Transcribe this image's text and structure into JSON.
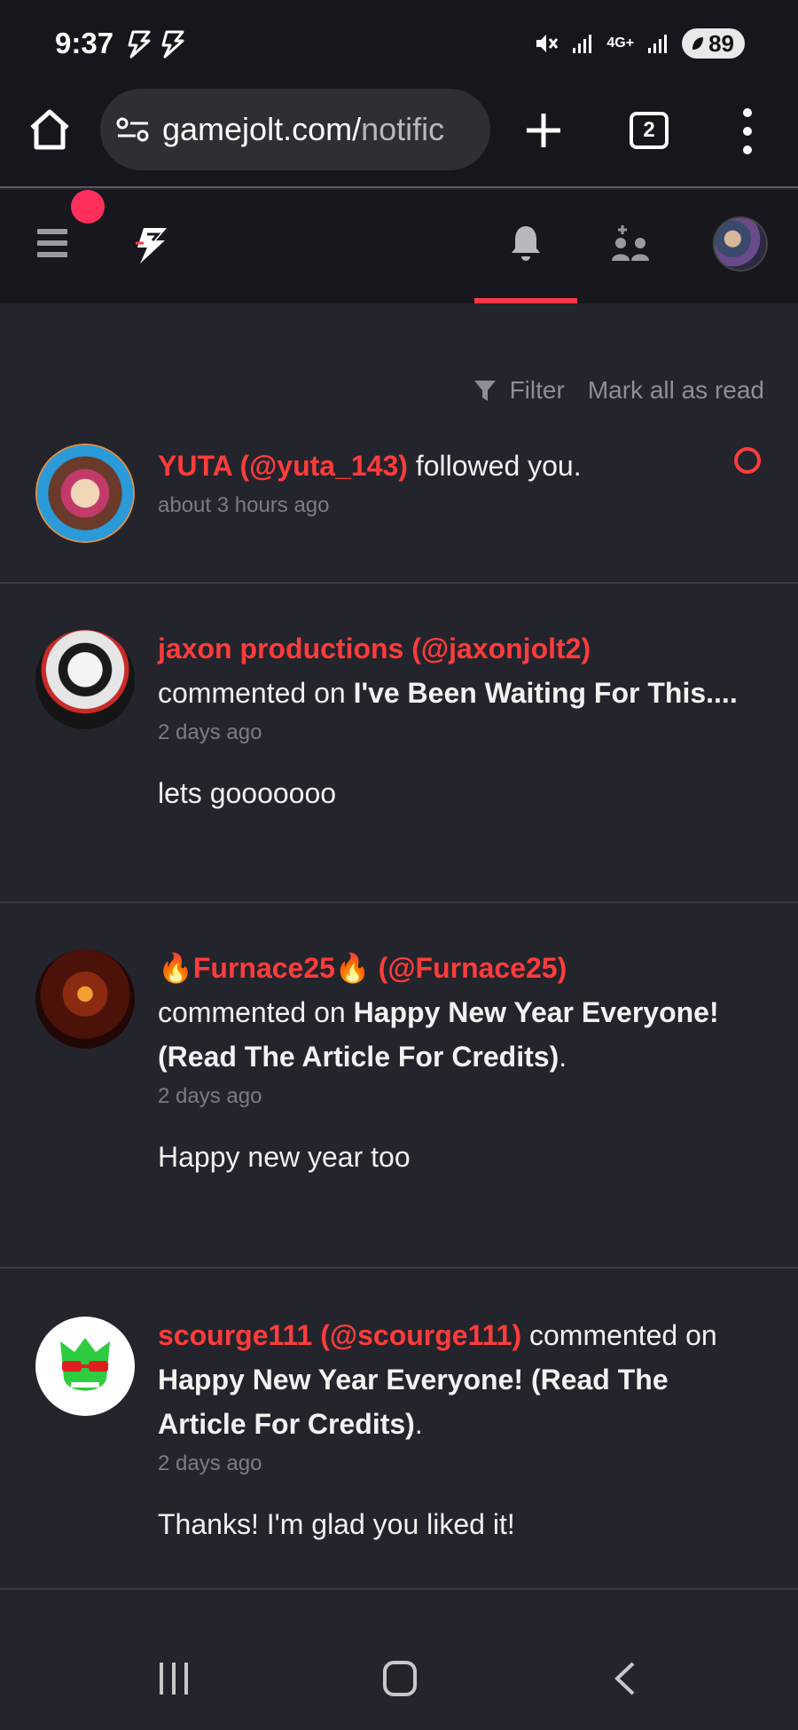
{
  "status_bar": {
    "time": "9:37",
    "network": "4G+",
    "battery": "89"
  },
  "browser": {
    "url_main": "gamejolt.com/",
    "url_tail": "notific",
    "tab_count": "2"
  },
  "toolbar": {
    "filter_label": "Filter",
    "mark_all_label": "Mark all as read"
  },
  "notifications": [
    {
      "user": "YUTA (@yuta_143)",
      "action": " followed you.",
      "time": "about 3 hours ago",
      "unread": true
    },
    {
      "user": "jaxon productions (@jaxonjolt2)",
      "action": "commented on ",
      "title": "I've Been Waiting For This....",
      "time": "2 days ago",
      "comment": "lets gooooooo"
    },
    {
      "user": "🔥Furnace25🔥 (@Furnace25)",
      "action": "commented on ",
      "title": "Happy New Year Everyone! (Read The Article For Credits)",
      "suffix": ".",
      "time": "2 days ago",
      "comment": "Happy new year too"
    },
    {
      "user": "scourge111 (@scourge111)",
      "action": " commented on ",
      "title": "Happy New Year Everyone! (Read The Article For Credits)",
      "suffix": ".",
      "time": "2 days ago",
      "comment": "Thanks! I'm glad you liked it!"
    }
  ],
  "colors": {
    "accent": "#ff3c3c",
    "bg": "#24242c",
    "header": "#17171d",
    "notif_dot": "#ff2f5c"
  }
}
